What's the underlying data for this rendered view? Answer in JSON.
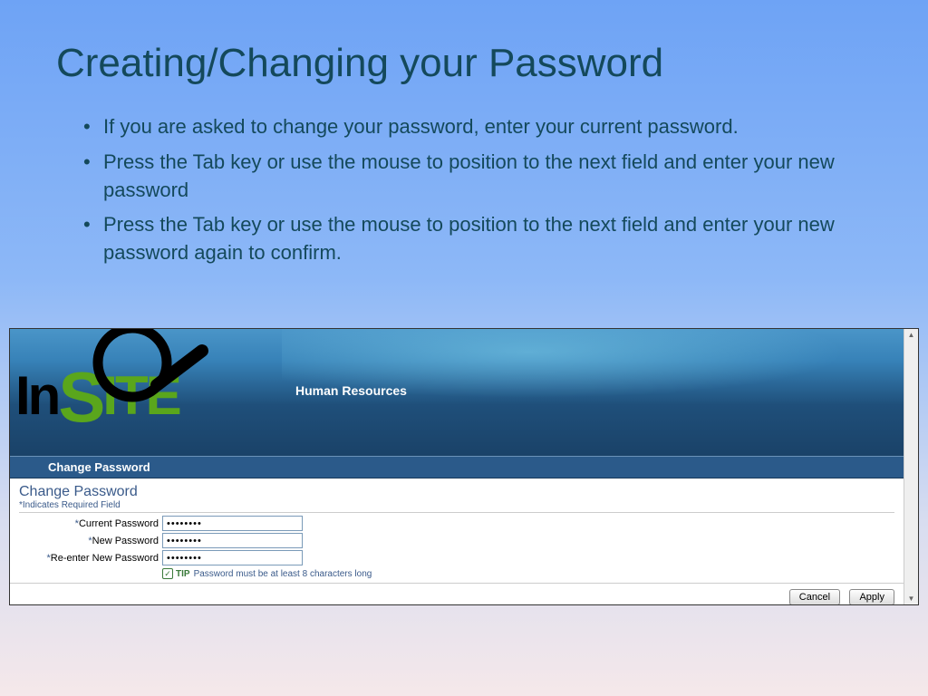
{
  "slide": {
    "title": "Creating/Changing your Password",
    "bullets": [
      "If you are asked to change your password, enter your current password.",
      "Press the Tab key or use the mouse to position to the next field and enter your new password",
      "Press the Tab key or use the mouse to position to the next field and enter your new password again to confirm."
    ]
  },
  "app": {
    "logo_text_1": "In",
    "logo_text_2": "S",
    "logo_text_3": "ITE",
    "header_label": "Human Resources",
    "navbar_title": "Change Password",
    "form": {
      "title": "Change Password",
      "required_note": "Indicates Required Field",
      "fields": {
        "current": {
          "label": "Current Password",
          "value": "••••••••"
        },
        "new": {
          "label": "New Password",
          "value": "••••••••"
        },
        "reenter": {
          "label": "Re-enter New Password",
          "value": "••••••••"
        }
      },
      "tip_label": "TIP",
      "tip_text": "Password must be at least 8 characters long"
    },
    "buttons": {
      "cancel": "Cancel",
      "apply": "Apply"
    }
  }
}
